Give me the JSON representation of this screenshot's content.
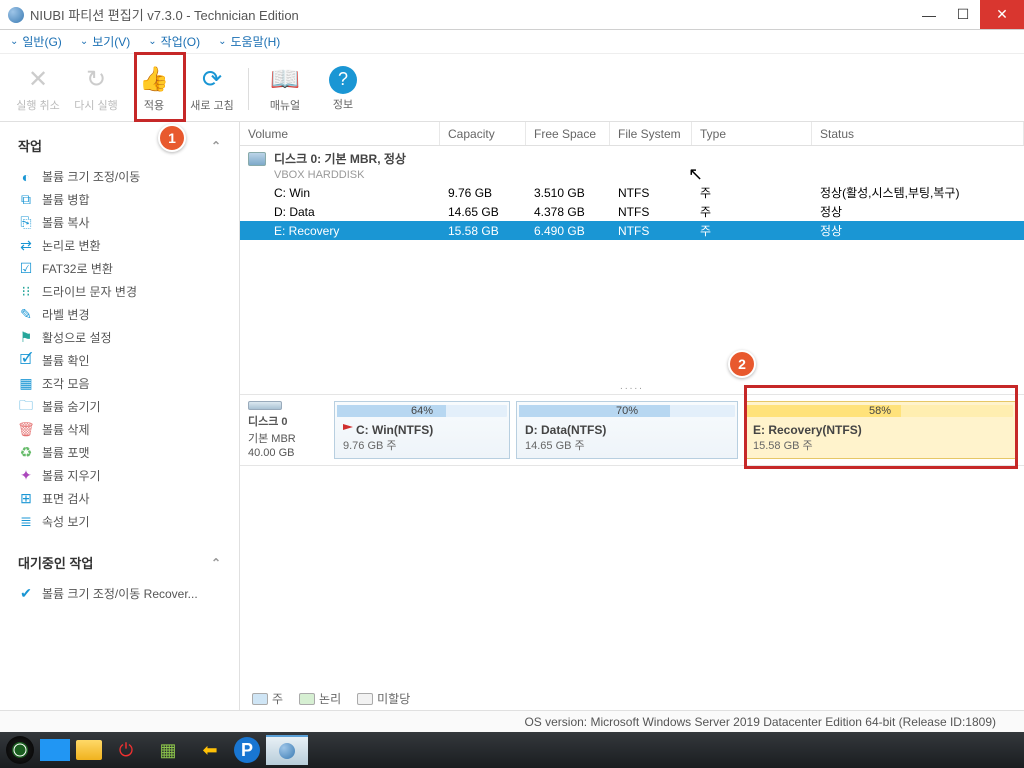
{
  "window": {
    "title": "NIUBI 파티션 편집기 v7.3.0 - Technician Edition"
  },
  "menu": {
    "general": "일반(G)",
    "view": "보기(V)",
    "action": "작업(O)",
    "help": "도움말(H)"
  },
  "toolbar": {
    "undo": "실행 취소",
    "redo": "다시 실행",
    "apply": "적용",
    "refresh": "새로 고침",
    "manual": "매뉴얼",
    "info": "정보"
  },
  "annotations": {
    "badge1": "1",
    "badge2": "2"
  },
  "sidebar": {
    "section1_title": "작업",
    "items": [
      {
        "label": "볼륨 크기 조정/이동",
        "color": "#1a96d4"
      },
      {
        "label": "볼륨 병합",
        "color": "#1a96d4"
      },
      {
        "label": "볼륨 복사",
        "color": "#1a96d4"
      },
      {
        "label": "논리로 변환",
        "color": "#1a96d4"
      },
      {
        "label": "FAT32로 변환",
        "color": "#1a96d4"
      },
      {
        "label": "드라이브 문자 변경",
        "color": "#26a69a"
      },
      {
        "label": "라벨 변경",
        "color": "#1a96d4"
      },
      {
        "label": "활성으로 설정",
        "color": "#26a69a"
      },
      {
        "label": "볼륨 확인",
        "color": "#1a96d4"
      },
      {
        "label": "조각 모음",
        "color": "#1a96d4"
      },
      {
        "label": "볼륨 숨기기",
        "color": "#1a96d4"
      },
      {
        "label": "볼륨 삭제",
        "color": "#e57373"
      },
      {
        "label": "볼륨 포맷",
        "color": "#66bb6a"
      },
      {
        "label": "볼륨 지우기",
        "color": "#ab47bc"
      },
      {
        "label": "표면 검사",
        "color": "#1a96d4"
      },
      {
        "label": "속성 보기",
        "color": "#1a96d4"
      }
    ],
    "section2_title": "대기중인 작업",
    "pending": [
      {
        "label": "볼륨 크기 조정/이동 Recover..."
      }
    ]
  },
  "table": {
    "headers": {
      "vol": "Volume",
      "cap": "Capacity",
      "free": "Free Space",
      "fs": "File System",
      "type": "Type",
      "status": "Status"
    },
    "disk_label": "디스크 0: 기본 MBR, 정상",
    "disk_sub": "VBOX HARDDISK",
    "rows": [
      {
        "vol": "C: Win",
        "cap": "9.76 GB",
        "free": "3.510 GB",
        "fs": "NTFS",
        "type": "주",
        "status": "정상(활성,시스템,부팅,복구)"
      },
      {
        "vol": "D: Data",
        "cap": "14.65 GB",
        "free": "4.378 GB",
        "fs": "NTFS",
        "type": "주",
        "status": "정상"
      },
      {
        "vol": "E: Recovery",
        "cap": "15.58 GB",
        "free": "6.490 GB",
        "fs": "NTFS",
        "type": "주",
        "status": "정상"
      }
    ]
  },
  "diskmap": {
    "label": "디스크 0",
    "scheme": "기본 MBR",
    "size": "40.00 GB",
    "parts": [
      {
        "pct": "64%",
        "name": "C: Win(NTFS)",
        "size": "9.76 GB 주",
        "fill": 64
      },
      {
        "pct": "70%",
        "name": "D: Data(NTFS)",
        "size": "14.65 GB 주",
        "fill": 70
      },
      {
        "pct": "58%",
        "name": "E: Recovery(NTFS)",
        "size": "15.58 GB 주",
        "fill": 58
      }
    ]
  },
  "legend": {
    "main": "주",
    "logic": "논리",
    "unalloc": "미할당"
  },
  "status": {
    "os": "OS version: Microsoft Windows Server 2019 Datacenter Edition  64-bit  (Release ID:1809)"
  }
}
